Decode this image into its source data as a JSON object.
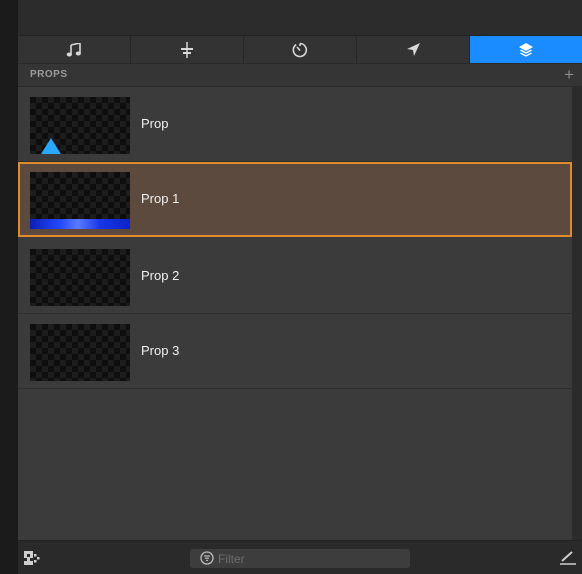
{
  "tabs": [
    {
      "icon": "music-icon",
      "active": false
    },
    {
      "icon": "align-icon",
      "active": false
    },
    {
      "icon": "timer-icon",
      "active": false
    },
    {
      "icon": "location-arrow-icon",
      "active": false
    },
    {
      "icon": "layers-icon",
      "active": true
    }
  ],
  "section": {
    "title": "PROPS",
    "add_label": "+"
  },
  "props": [
    {
      "label": "Prop",
      "thumbnail": "blue-triangle",
      "selected": false
    },
    {
      "label": "Prop 1",
      "thumbnail": "blue-wave",
      "selected": true
    },
    {
      "label": "Prop 2",
      "thumbnail": "empty",
      "selected": false
    },
    {
      "label": "Prop 3",
      "thumbnail": "empty",
      "selected": false
    }
  ],
  "filter": {
    "placeholder": "Filter",
    "value": ""
  },
  "colors": {
    "accent": "#1a8cff",
    "selection_border": "#e08a2e",
    "selection_fill": "#5c4a3e",
    "panel": "#3b3b3b",
    "triangle": "#2aa8ff"
  }
}
